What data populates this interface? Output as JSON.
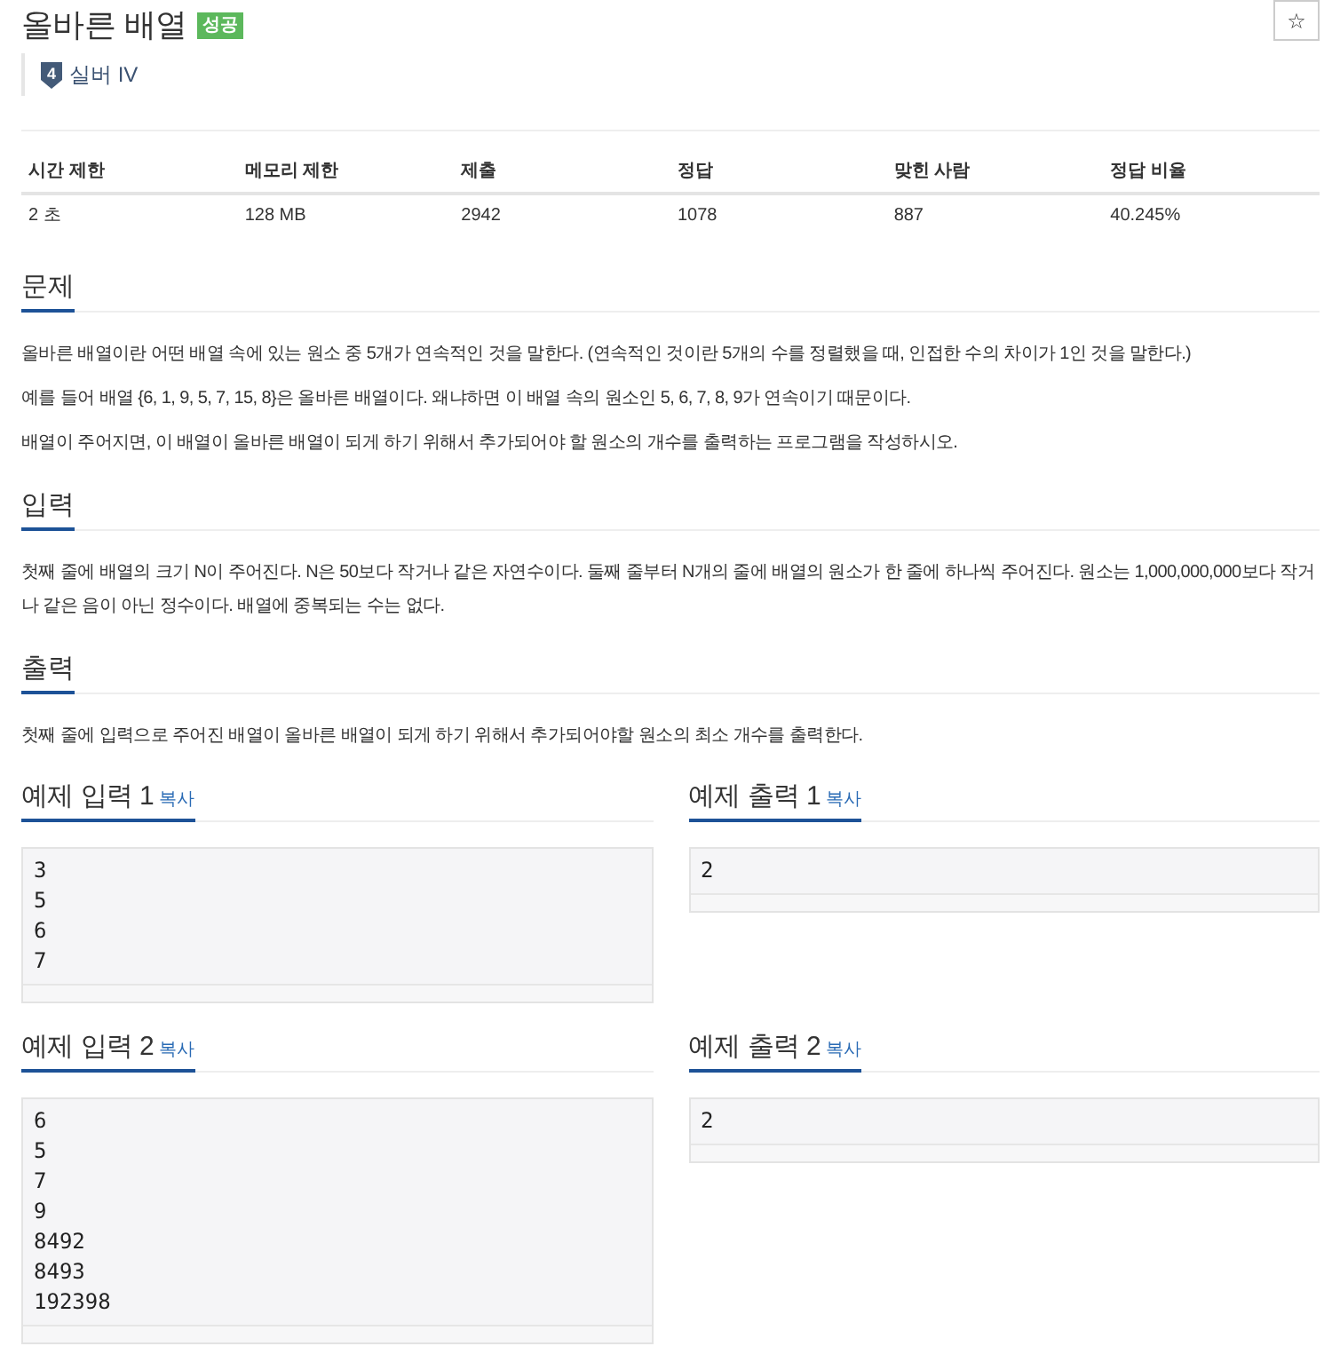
{
  "header": {
    "title": "올바른 배열",
    "result_badge": "성공",
    "favorite_button": "☆"
  },
  "tier": {
    "number": "4",
    "name": "실버 IV"
  },
  "info_table": {
    "columns": [
      "시간 제한",
      "메모리 제한",
      "제출",
      "정답",
      "맞힌 사람",
      "정답 비율"
    ],
    "rows": [
      [
        "2 초",
        "128 MB",
        "2942",
        "1078",
        "887",
        "40.245%"
      ]
    ]
  },
  "sections": [
    {
      "title": "문제",
      "paragraphs": [
        "올바른 배열이란 어떤 배열 속에 있는 원소 중 5개가 연속적인 것을 말한다. (연속적인 것이란 5개의 수를 정렬했을 때, 인접한 수의 차이가 1인 것을 말한다.)",
        "예를 들어 배열 {6, 1, 9, 5, 7, 15, 8}은 올바른 배열이다. 왜냐하면 이 배열 속의 원소인 5, 6, 7, 8, 9가 연속이기 때문이다.",
        "배열이 주어지면, 이 배열이 올바른 배열이 되게 하기 위해서 추가되어야 할 원소의 개수를 출력하는 프로그램을 작성하시오."
      ]
    },
    {
      "title": "입력",
      "paragraphs": [
        "첫째 줄에 배열의 크기 N이 주어진다. N은 50보다 작거나 같은 자연수이다. 둘째 줄부터 N개의 줄에 배열의 원소가 한 줄에 하나씩 주어진다. 원소는 1,000,000,000보다 작거나 같은 음이 아닌 정수이다. 배열에 중복되는 수는 없다."
      ]
    },
    {
      "title": "출력",
      "paragraphs": [
        "첫째 줄에 입력으로 주어진 배열이 올바른 배열이 되게 하기 위해서 추가되어야할 원소의 최소 개수를 출력한다."
      ]
    }
  ],
  "samples": [
    {
      "input": {
        "title": "예제 입력 1",
        "copy_link": "복사",
        "text": "3\n5\n6\n7"
      },
      "output": {
        "title": "예제 출력 1",
        "copy_link": "복사",
        "text": "2"
      }
    },
    {
      "input": {
        "title": "예제 입력 2",
        "copy_link": "복사",
        "text": "6\n5\n7\n9\n8492\n8493\n192398"
      },
      "output": {
        "title": "예제 출력 2",
        "copy_link": "복사",
        "text": "2"
      }
    }
  ]
}
